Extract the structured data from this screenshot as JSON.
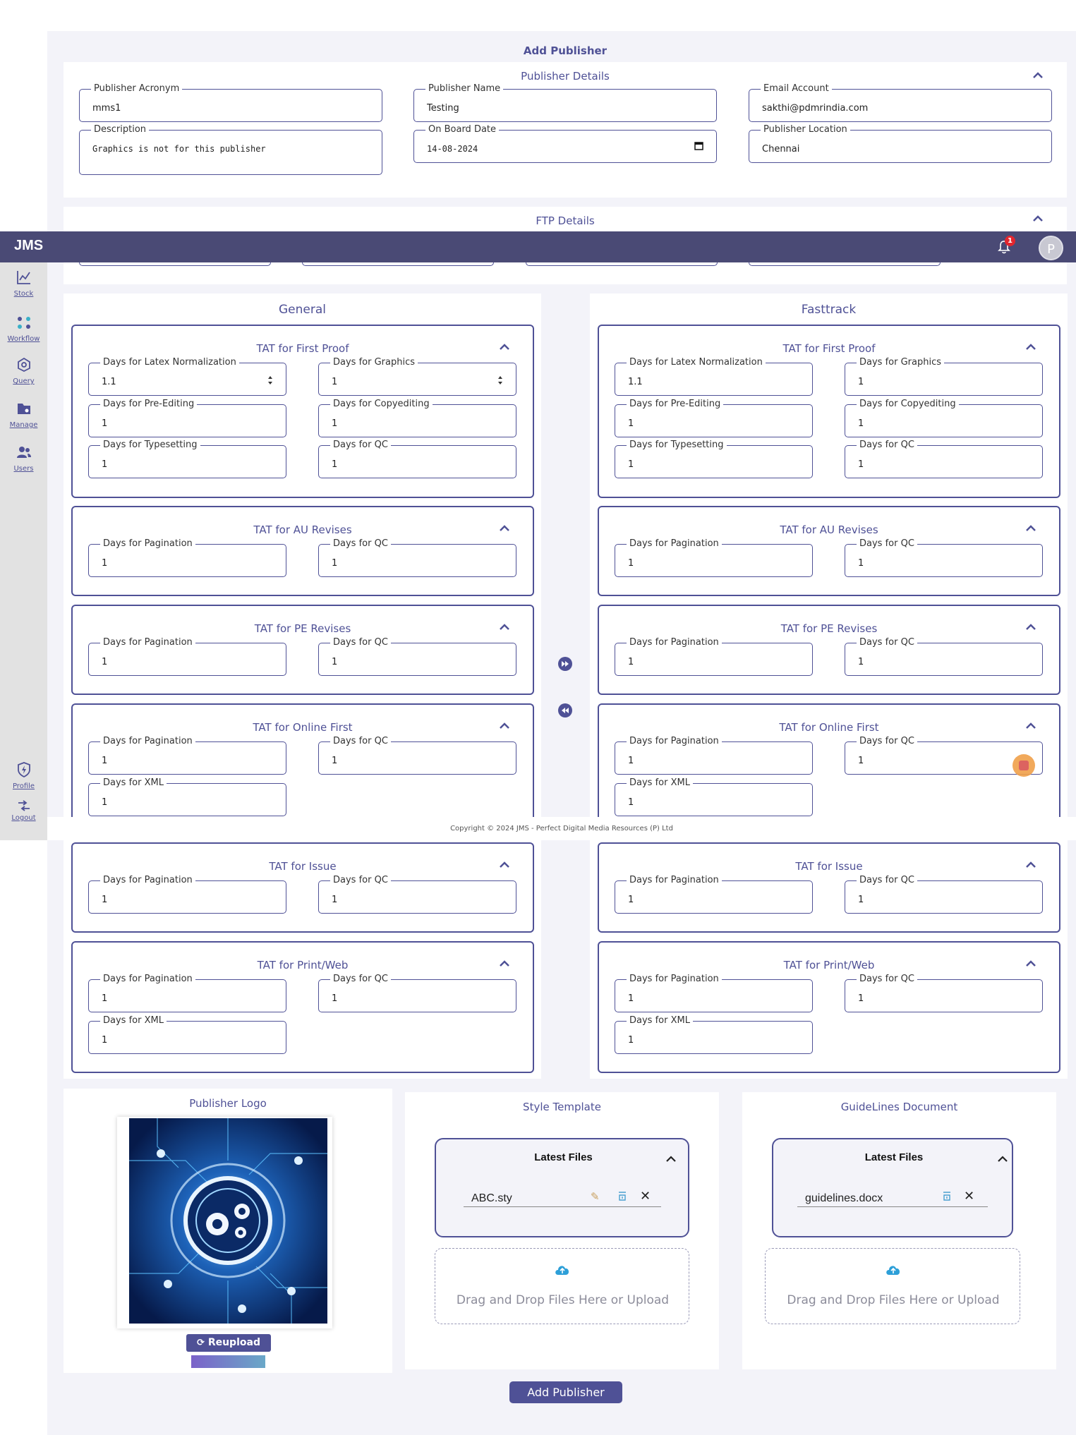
{
  "app": {
    "brand": "JMS",
    "notification_count": "1",
    "avatar_initial": "P",
    "copyright": "Copyright © 2024 JMS - Perfect Digital Media Resources (P) Ltd"
  },
  "sidebar": {
    "items": [
      {
        "label": "Stock",
        "icon": "chart-line-icon"
      },
      {
        "label": "Workflow",
        "icon": "workflow-icon"
      },
      {
        "label": "Query",
        "icon": "query-icon"
      },
      {
        "label": "Manage",
        "icon": "folder-icon"
      },
      {
        "label": "Users",
        "icon": "users-icon"
      },
      {
        "label": "Profile",
        "icon": "shield-icon"
      },
      {
        "label": "Logout",
        "icon": "logout-icon"
      }
    ]
  },
  "page_title": "Add Publisher",
  "publisher_details": {
    "title": "Publisher Details",
    "acronym": {
      "label": "Publisher Acronym",
      "value": "mms1"
    },
    "name": {
      "label": "Publisher Name",
      "value": "Testing"
    },
    "email": {
      "label": "Email Account",
      "value": "sakthi@pdmrindia.com"
    },
    "description": {
      "label": "Description",
      "value": "Graphics is not for this publisher"
    },
    "onboard": {
      "label": "On Board Date",
      "value": "14-08-2024"
    },
    "location": {
      "label": "Publisher Location",
      "value": "Chennai"
    }
  },
  "ftp": {
    "title": "FTP Details"
  },
  "general": {
    "title": "General",
    "first_proof": {
      "title": "TAT for First Proof",
      "latex": {
        "label": "Days for Latex Normalization",
        "value": "1.1"
      },
      "graphics": {
        "label": "Days for Graphics",
        "value": "1"
      },
      "preediting": {
        "label": "Days for Pre-Editing",
        "value": "1"
      },
      "copyediting": {
        "label": "Days for Copyediting",
        "value": "1"
      },
      "typesetting": {
        "label": "Days for Typesetting",
        "value": "1"
      },
      "qc": {
        "label": "Days for QC",
        "value": "1"
      }
    },
    "au": {
      "title": "TAT for AU Revises",
      "pagination": {
        "label": "Days for Pagination",
        "value": "1"
      },
      "qc": {
        "label": "Days for QC",
        "value": "1"
      }
    },
    "pe": {
      "title": "TAT for PE Revises",
      "pagination": {
        "label": "Days for Pagination",
        "value": "1"
      },
      "qc": {
        "label": "Days for QC",
        "value": "1"
      }
    },
    "online": {
      "title": "TAT for Online First",
      "pagination": {
        "label": "Days for Pagination",
        "value": "1"
      },
      "qc": {
        "label": "Days for QC",
        "value": "1"
      },
      "xml": {
        "label": "Days for XML",
        "value": "1"
      }
    },
    "issue": {
      "title": "TAT for Issue",
      "pagination": {
        "label": "Days for Pagination",
        "value": "1"
      },
      "qc": {
        "label": "Days for QC",
        "value": "1"
      }
    },
    "print": {
      "title": "TAT for Print/Web",
      "pagination": {
        "label": "Days for Pagination",
        "value": "1"
      },
      "qc": {
        "label": "Days for QC",
        "value": "1"
      },
      "xml": {
        "label": "Days for XML",
        "value": "1"
      }
    }
  },
  "fasttrack": {
    "title": "Fasttrack",
    "first_proof": {
      "title": "TAT for First Proof",
      "latex": {
        "label": "Days for Latex Normalization",
        "value": "1.1"
      },
      "graphics": {
        "label": "Days for Graphics",
        "value": "1"
      },
      "preediting": {
        "label": "Days for Pre-Editing",
        "value": "1"
      },
      "copyediting": {
        "label": "Days for Copyediting",
        "value": "1"
      },
      "typesetting": {
        "label": "Days for Typesetting",
        "value": "1"
      },
      "qc": {
        "label": "Days for QC",
        "value": "1"
      }
    },
    "au": {
      "title": "TAT for AU Revises",
      "pagination": {
        "label": "Days for Pagination",
        "value": "1"
      },
      "qc": {
        "label": "Days for QC",
        "value": "1"
      }
    },
    "pe": {
      "title": "TAT for PE Revises",
      "pagination": {
        "label": "Days for Pagination",
        "value": "1"
      },
      "qc": {
        "label": "Days for QC",
        "value": "1"
      }
    },
    "online": {
      "title": "TAT for Online First",
      "pagination": {
        "label": "Days for Pagination",
        "value": "1"
      },
      "qc": {
        "label": "Days for QC",
        "value": "1"
      },
      "xml": {
        "label": "Days for XML",
        "value": "1"
      }
    },
    "issue": {
      "title": "TAT for Issue",
      "pagination": {
        "label": "Days for Pagination",
        "value": "1"
      },
      "qc": {
        "label": "Days for QC",
        "value": "1"
      }
    },
    "print": {
      "title": "TAT for Print/Web",
      "pagination": {
        "label": "Days for Pagination",
        "value": "1"
      },
      "qc": {
        "label": "Days for QC",
        "value": "1"
      },
      "xml": {
        "label": "Days for XML",
        "value": "1"
      }
    }
  },
  "logo": {
    "title": "Publisher Logo",
    "reupload": "Reupload"
  },
  "style_template": {
    "title": "Style Template",
    "latest": "Latest Files",
    "file": "ABC.sty",
    "drop": "Drag and Drop Files Here or Upload"
  },
  "guidelines": {
    "title": "GuideLines Document",
    "latest": "Latest Files",
    "file": "guidelines.docx",
    "drop": "Drag and Drop Files Here or Upload"
  },
  "submit": "Add Publisher",
  "colors": {
    "primary": "#4f5196",
    "navbar": "#4a4a75",
    "badge": "#e3262e",
    "bg": "#f3f3f9"
  }
}
